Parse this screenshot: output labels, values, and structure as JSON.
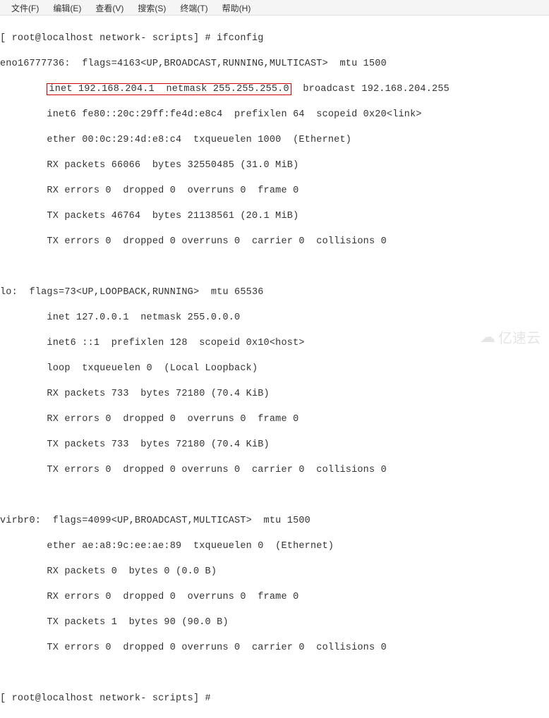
{
  "menubar": {
    "file": "文件(F)",
    "edit": "编辑(E)",
    "view": "查看(V)",
    "search": "搜索(S)",
    "terminal": "终端(T)",
    "help": "帮助(H)"
  },
  "prompt1": {
    "text": "[ root@localhost network- scripts] # ifconfig"
  },
  "eno": {
    "header": "eno16777736:  flags=4163<UP,BROADCAST,RUNNING,MULTICAST>  mtu 1500",
    "inet_pre": "        ",
    "inet_box": "inet 192.168.204.1  netmask 255.255.255.0",
    "inet_post": "  broadcast 192.168.204.255",
    "inet6": "        inet6 fe80::20c:29ff:fe4d:e8c4  prefixlen 64  scopeid 0x20<link>",
    "ether": "        ether 00:0c:29:4d:e8:c4  txqueuelen 1000  (Ethernet)",
    "rxp": "        RX packets 66066  bytes 32550485 (31.0 MiB)",
    "rxe": "        RX errors 0  dropped 0  overruns 0  frame 0",
    "txp": "        TX packets 46764  bytes 21138561 (20.1 MiB)",
    "txe": "        TX errors 0  dropped 0 overruns 0  carrier 0  collisions 0"
  },
  "lo": {
    "header": "lo:  flags=73<UP,LOOPBACK,RUNNING>  mtu 65536",
    "inet": "        inet 127.0.0.1  netmask 255.0.0.0",
    "inet6": "        inet6 ::1  prefixlen 128  scopeid 0x10<host>",
    "loop": "        loop  txqueuelen 0  (Local Loopback)",
    "rxp": "        RX packets 733  bytes 72180 (70.4 KiB)",
    "rxe": "        RX errors 0  dropped 0  overruns 0  frame 0",
    "txp": "        TX packets 733  bytes 72180 (70.4 KiB)",
    "txe": "        TX errors 0  dropped 0 overruns 0  carrier 0  collisions 0"
  },
  "virbr0": {
    "header": "virbr0:  flags=4099<UP,BROADCAST,MULTICAST>  mtu 1500",
    "ether": "        ether ae:a8:9c:ee:ae:89  txqueuelen 0  (Ethernet)",
    "rxp": "        RX packets 0  bytes 0 (0.0 B)",
    "rxe": "        RX errors 0  dropped 0  overruns 0  frame 0",
    "txp": "        TX packets 1  bytes 90 (90.0 B)",
    "txe": "        TX errors 0  dropped 0 overruns 0  carrier 0  collisions 0"
  },
  "prompt2": {
    "text": "[ root@localhost network- scripts] # "
  },
  "watermark": {
    "text": "亿速云"
  }
}
